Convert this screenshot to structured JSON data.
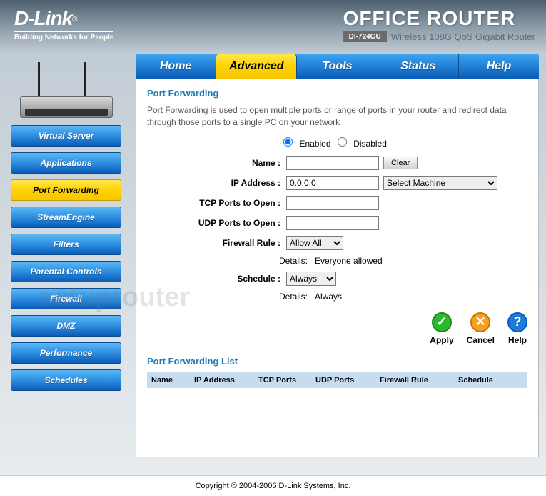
{
  "brand": {
    "name": "D-Link",
    "tagline": "Building Networks for People"
  },
  "product": {
    "title": "OFFICE ROUTER",
    "model": "DI-724GU",
    "desc": "Wireless 108G QoS Gigabit Router"
  },
  "sidebar": {
    "items": [
      {
        "label": "Virtual Server"
      },
      {
        "label": "Applications"
      },
      {
        "label": "Port Forwarding"
      },
      {
        "label": "StreamEngine"
      },
      {
        "label": "Filters"
      },
      {
        "label": "Parental Controls"
      },
      {
        "label": "Firewall"
      },
      {
        "label": "DMZ"
      },
      {
        "label": "Performance"
      },
      {
        "label": "Schedules"
      }
    ],
    "activeIndex": 2
  },
  "tabs": {
    "items": [
      "Home",
      "Advanced",
      "Tools",
      "Status",
      "Help"
    ],
    "activeIndex": 1
  },
  "page": {
    "title": "Port Forwarding",
    "description": "Port Forwarding is used to open multiple ports or range of ports in your router and redirect data through those ports to a single PC on your network",
    "radio": {
      "enabled": "Enabled",
      "disabled": "Disabled",
      "value": "enabled"
    },
    "fields": {
      "name_label": "Name :",
      "name_value": "",
      "clear_btn": "Clear",
      "ip_label": "IP Address :",
      "ip_value": "0.0.0.0",
      "machine_select": "Select Machine",
      "tcp_label": "TCP Ports to Open :",
      "tcp_value": "",
      "udp_label": "UDP Ports to Open :",
      "udp_value": "",
      "firewall_label": "Firewall Rule :",
      "firewall_value": "Allow All",
      "firewall_details_label": "Details:",
      "firewall_details": "Everyone allowed",
      "schedule_label": "Schedule :",
      "schedule_value": "Always",
      "schedule_details_label": "Details:",
      "schedule_details": "Always"
    },
    "actions": {
      "apply": "Apply",
      "cancel": "Cancel",
      "help": "Help"
    },
    "list": {
      "title": "Port Forwarding List",
      "headers": {
        "name": "Name",
        "ip": "IP Address",
        "tcp": "TCP Ports",
        "udp": "UDP Ports",
        "fw": "Firewall Rule",
        "sch": "Schedule"
      }
    }
  },
  "copyright": "Copyright © 2004-2006 D-Link Systems, Inc.",
  "watermark": "setuprouter"
}
